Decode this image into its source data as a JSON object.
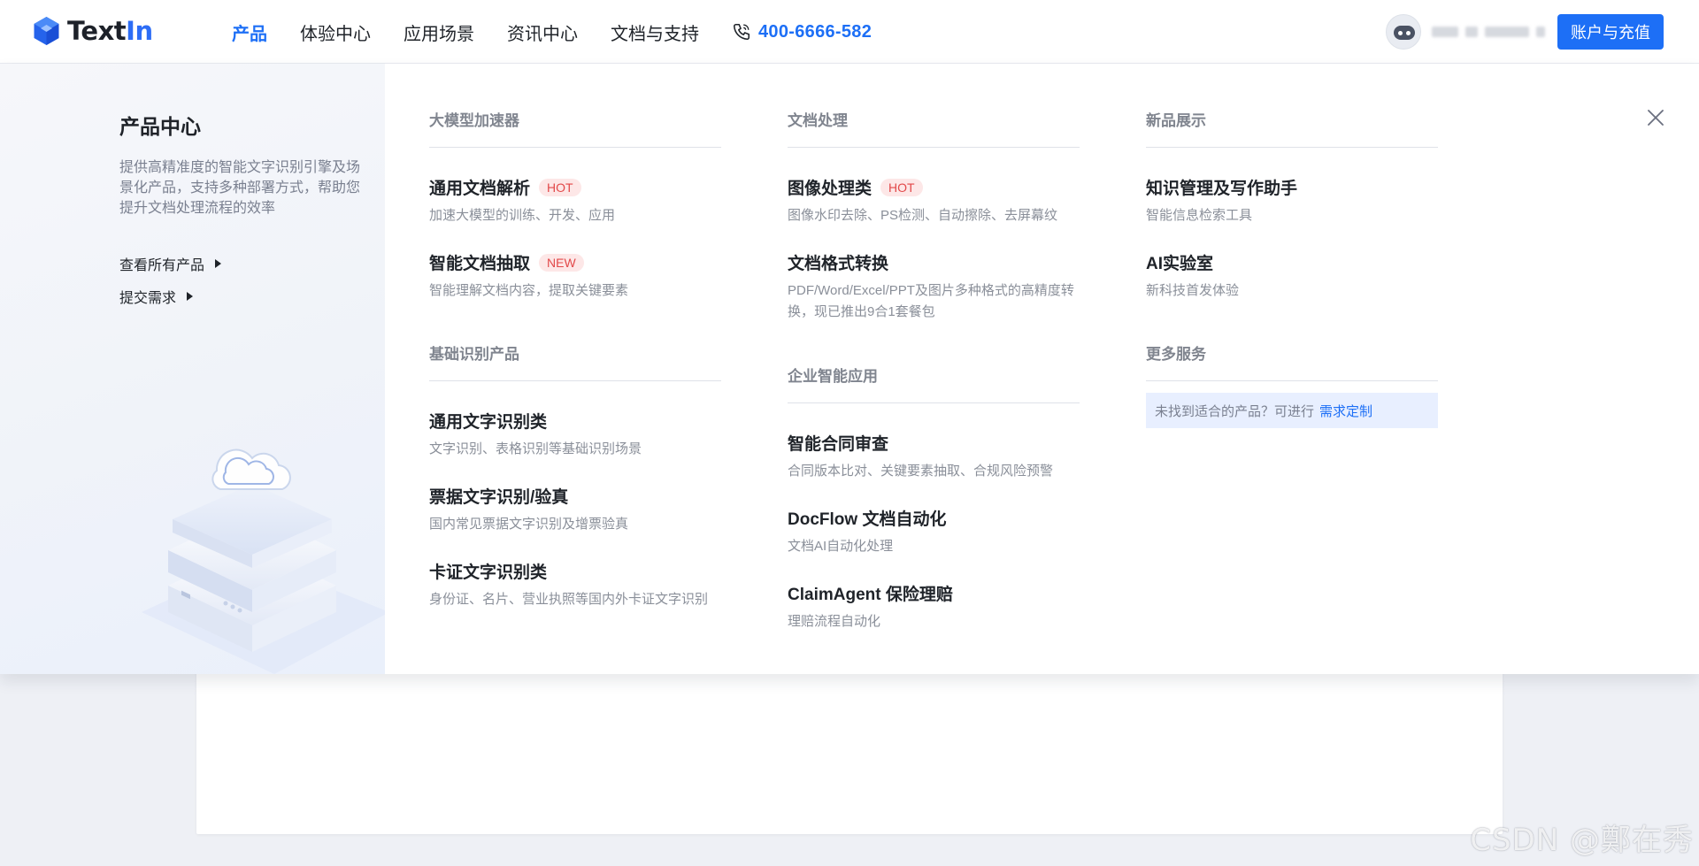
{
  "header": {
    "logo": {
      "text_main": "Text",
      "text_accent": "In"
    },
    "nav": [
      {
        "label": "产品",
        "active": true
      },
      {
        "label": "体验中心"
      },
      {
        "label": "应用场景"
      },
      {
        "label": "资讯中心"
      },
      {
        "label": "文档与支持"
      }
    ],
    "phone": "400-6666-582",
    "recharge_label": "账户与充值",
    "icons": {
      "phone": "phone-icon",
      "avatar": "robot-avatar-icon",
      "close": "close-icon"
    }
  },
  "menu": {
    "left": {
      "title": "产品中心",
      "description": "提供高精准度的智能文字识别引擎及场景化产品，支持多种部署方式，帮助您提升文档处理流程的效率",
      "links": [
        "查看所有产品",
        "提交需求"
      ]
    },
    "col1": {
      "sections": [
        {
          "heading": "大模型加速器",
          "items": [
            {
              "title": "通用文档解析",
              "badge": "HOT",
              "subtitle": "加速大模型的训练、开发、应用"
            },
            {
              "title": "智能文档抽取",
              "badge": "NEW",
              "subtitle": "智能理解文档内容，提取关键要素"
            }
          ]
        },
        {
          "heading": "基础识别产品",
          "items": [
            {
              "title": "通用文字识别类",
              "subtitle": "文字识别、表格识别等基础识别场景"
            },
            {
              "title": "票据文字识别/验真",
              "subtitle": "国内常见票据文字识别及增票验真"
            },
            {
              "title": "卡证文字识别类",
              "subtitle": "身份证、名片、营业执照等国内外卡证文字识别"
            }
          ]
        }
      ]
    },
    "col2": {
      "sections": [
        {
          "heading": "文档处理",
          "items": [
            {
              "title": "图像处理类",
              "badge": "HOT",
              "subtitle": "图像水印去除、PS检测、自动擦除、去屏幕纹"
            },
            {
              "title": "文档格式转换",
              "subtitle": "PDF/Word/Excel/PPT及图片多种格式的高精度转换，现已推出9合1套餐包"
            }
          ]
        },
        {
          "heading": "企业智能应用",
          "items": [
            {
              "title": "智能合同审查",
              "subtitle": "合同版本比对、关键要素抽取、合规风险预警"
            },
            {
              "title": "DocFlow 文档自动化",
              "subtitle": "文档AI自动化处理"
            },
            {
              "title": "ClaimAgent 保险理赔",
              "subtitle": "理赔流程自动化"
            }
          ]
        }
      ]
    },
    "col3": {
      "sections": [
        {
          "heading": "新品展示",
          "items": [
            {
              "title": "知识管理及写作助手",
              "subtitle": "智能信息检索工具"
            },
            {
              "title": "AI实验室",
              "subtitle": "新科技首发体验"
            }
          ]
        },
        {
          "heading": "更多服务",
          "custom_text": "未找到适合的产品？可进行",
          "custom_link": "需求定制"
        }
      ]
    }
  },
  "watermark": "CSDN @鄭在秀",
  "colors": {
    "accent": "#1d6ff6",
    "hot": "#e2494a",
    "badge_bg": "#fde7e7"
  }
}
